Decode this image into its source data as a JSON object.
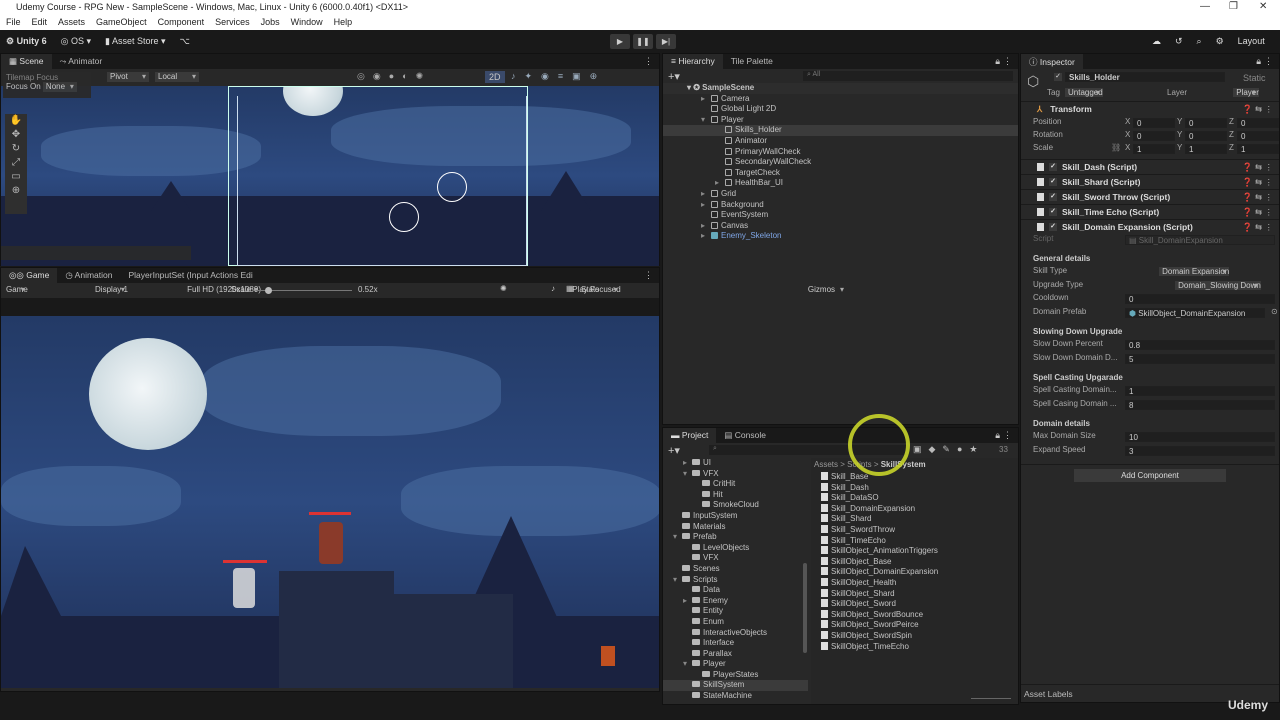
{
  "window": {
    "title": "Udemy Course - RPG New - SampleScene - Windows, Mac, Linux - Unity 6 (6000.0.40f1) <DX11>"
  },
  "menu": [
    "File",
    "Edit",
    "Assets",
    "GameObject",
    "Component",
    "Services",
    "Jobs",
    "Window",
    "Help"
  ],
  "toolbar": {
    "unity": "Unity 6",
    "os": "OS",
    "asset_store": "Asset Store",
    "layout": "Layout"
  },
  "scene": {
    "tabs": [
      "Scene",
      "Animator"
    ],
    "tilemap_focus": "Tilemap Focus",
    "focus_on": "Focus On",
    "focus_value": "None",
    "pivot": "Pivot",
    "local": "Local",
    "mode2d": "2D"
  },
  "game": {
    "tabs": [
      "Game",
      "Animation",
      "PlayerInputSet (Input Actions Edi"
    ],
    "mode": "Game",
    "display": "Display 1",
    "resolution": "Full HD (1920x1080)",
    "scale_label": "Scale",
    "scale_value": "0.52x",
    "scale_fraction": 0.1,
    "play_focused": "Play Focused",
    "stats": "Stats",
    "gizmos": "Gizmos"
  },
  "hierarchy": {
    "tabs": [
      "Hierarchy",
      "Tile Palette"
    ],
    "search_placeholder": "All",
    "scene": "SampleScene",
    "items": [
      {
        "label": "Camera",
        "depth": 1,
        "expand": "▸"
      },
      {
        "label": "Global Light 2D",
        "depth": 1,
        "expand": ""
      },
      {
        "label": "Player",
        "depth": 1,
        "expand": "▾"
      },
      {
        "label": "Skills_Holder",
        "depth": 2,
        "expand": "",
        "selected": true
      },
      {
        "label": "Animator",
        "depth": 2,
        "expand": ""
      },
      {
        "label": "PrimaryWallCheck",
        "depth": 2,
        "expand": ""
      },
      {
        "label": "SecondaryWallCheck",
        "depth": 2,
        "expand": ""
      },
      {
        "label": "TargetCheck",
        "depth": 2,
        "expand": ""
      },
      {
        "label": "HealthBar_UI",
        "depth": 2,
        "expand": "▸"
      },
      {
        "label": "Grid",
        "depth": 1,
        "expand": "▸"
      },
      {
        "label": "Background",
        "depth": 1,
        "expand": "▸"
      },
      {
        "label": "EventSystem",
        "depth": 1,
        "expand": ""
      },
      {
        "label": "Canvas",
        "depth": 1,
        "expand": "▸"
      },
      {
        "label": "Enemy_Skeleton",
        "depth": 1,
        "expand": "▸",
        "prefab": true
      }
    ]
  },
  "project": {
    "tabs": [
      "Project",
      "Console"
    ],
    "count": "33",
    "breadcrumb": [
      "Assets",
      "Scripts",
      "SkillSystem"
    ],
    "tree": [
      {
        "label": "UI",
        "depth": 1,
        "expand": "▸"
      },
      {
        "label": "VFX",
        "depth": 1,
        "expand": "▾"
      },
      {
        "label": "CritHit",
        "depth": 2,
        "expand": ""
      },
      {
        "label": "Hit",
        "depth": 2,
        "expand": ""
      },
      {
        "label": "SmokeCloud",
        "depth": 2,
        "expand": ""
      },
      {
        "label": "InputSystem",
        "depth": 0,
        "expand": ""
      },
      {
        "label": "Materials",
        "depth": 0,
        "expand": ""
      },
      {
        "label": "Prefab",
        "depth": 0,
        "expand": "▾"
      },
      {
        "label": "LevelObjects",
        "depth": 1,
        "expand": ""
      },
      {
        "label": "VFX",
        "depth": 1,
        "expand": ""
      },
      {
        "label": "Scenes",
        "depth": 0,
        "expand": ""
      },
      {
        "label": "Scripts",
        "depth": 0,
        "expand": "▾"
      },
      {
        "label": "Data",
        "depth": 1,
        "expand": ""
      },
      {
        "label": "Enemy",
        "depth": 1,
        "expand": "▸"
      },
      {
        "label": "Entity",
        "depth": 1,
        "expand": ""
      },
      {
        "label": "Enum",
        "depth": 1,
        "expand": ""
      },
      {
        "label": "InteractiveObjects",
        "depth": 1,
        "expand": ""
      },
      {
        "label": "Interface",
        "depth": 1,
        "expand": ""
      },
      {
        "label": "Parallax",
        "depth": 1,
        "expand": ""
      },
      {
        "label": "Player",
        "depth": 1,
        "expand": "▾"
      },
      {
        "label": "PlayerStates",
        "depth": 2,
        "expand": ""
      },
      {
        "label": "SkillSystem",
        "depth": 1,
        "expand": "",
        "selected": true
      },
      {
        "label": "StateMachine",
        "depth": 1,
        "expand": ""
      }
    ],
    "files": [
      "Skill_Base",
      "Skill_Dash",
      "Skill_DataSO",
      "Skill_DomainExpansion",
      "Skill_Shard",
      "Skill_SwordThrow",
      "Skill_TimeEcho",
      "SkillObject_AnimationTriggers",
      "SkillObject_Base",
      "SkillObject_DomainExpansion",
      "SkillObject_Health",
      "SkillObject_Shard",
      "SkillObject_Sword",
      "SkillObject_SwordBounce",
      "SkillObject_SwordPeirce",
      "SkillObject_SwordSpin",
      "SkillObject_TimeEcho"
    ]
  },
  "inspector": {
    "tab": "Inspector",
    "name": "Skills_Holder",
    "static": "Static",
    "tag_label": "Tag",
    "tag": "Untagged",
    "layer_label": "Layer",
    "layer": "Player",
    "transform": {
      "title": "Transform",
      "rows": [
        {
          "label": "Position",
          "x": "0",
          "y": "0",
          "z": "0"
        },
        {
          "label": "Rotation",
          "x": "0",
          "y": "0",
          "z": "0"
        },
        {
          "label": "Scale",
          "x": "1",
          "y": "1",
          "z": "1"
        }
      ]
    },
    "components": [
      "Skill_Dash (Script)",
      "Skill_Shard (Script)",
      "Skill_Sword Throw (Script)",
      "Skill_Time Echo (Script)",
      "Skill_Domain Expansion (Script)"
    ],
    "script_label": "Script",
    "script_value": "Skill_DomainExpansion",
    "sections": [
      {
        "title": "General details",
        "fields": [
          {
            "label": "Skill Type",
            "value": "Domain Expansion",
            "kind": "dropdown"
          },
          {
            "label": "Upgrade Type",
            "value": "Domain_Slowing Down",
            "kind": "dropdown"
          },
          {
            "label": "Cooldown",
            "value": "0",
            "kind": "field"
          },
          {
            "label": "Domain Prefab",
            "value": "SkillObject_DomainExpansion",
            "kind": "object"
          }
        ]
      },
      {
        "title": "Slowing Down Upgrade",
        "fields": [
          {
            "label": "Slow Down Percent",
            "value": "0.8",
            "kind": "field"
          },
          {
            "label": "Slow Down Domain D...",
            "value": "5",
            "kind": "field"
          }
        ]
      },
      {
        "title": "Spell Casting Upgarade",
        "fields": [
          {
            "label": "Spell Casting Domain...",
            "value": "1",
            "kind": "field"
          },
          {
            "label": "Spell Casing Domain ...",
            "value": "8",
            "kind": "field"
          }
        ]
      },
      {
        "title": "Domain details",
        "fields": [
          {
            "label": "Max Domain Size",
            "value": "10",
            "kind": "field"
          },
          {
            "label": "Expand Speed",
            "value": "3",
            "kind": "field"
          }
        ]
      }
    ],
    "add_component": "Add Component",
    "asset_labels": "Asset Labels"
  },
  "watermark": "Udemy",
  "colors": {
    "accent_cursor": "#c8d42a",
    "prefab_blue": "#7fa6e6",
    "sky": "#2d4a80"
  }
}
